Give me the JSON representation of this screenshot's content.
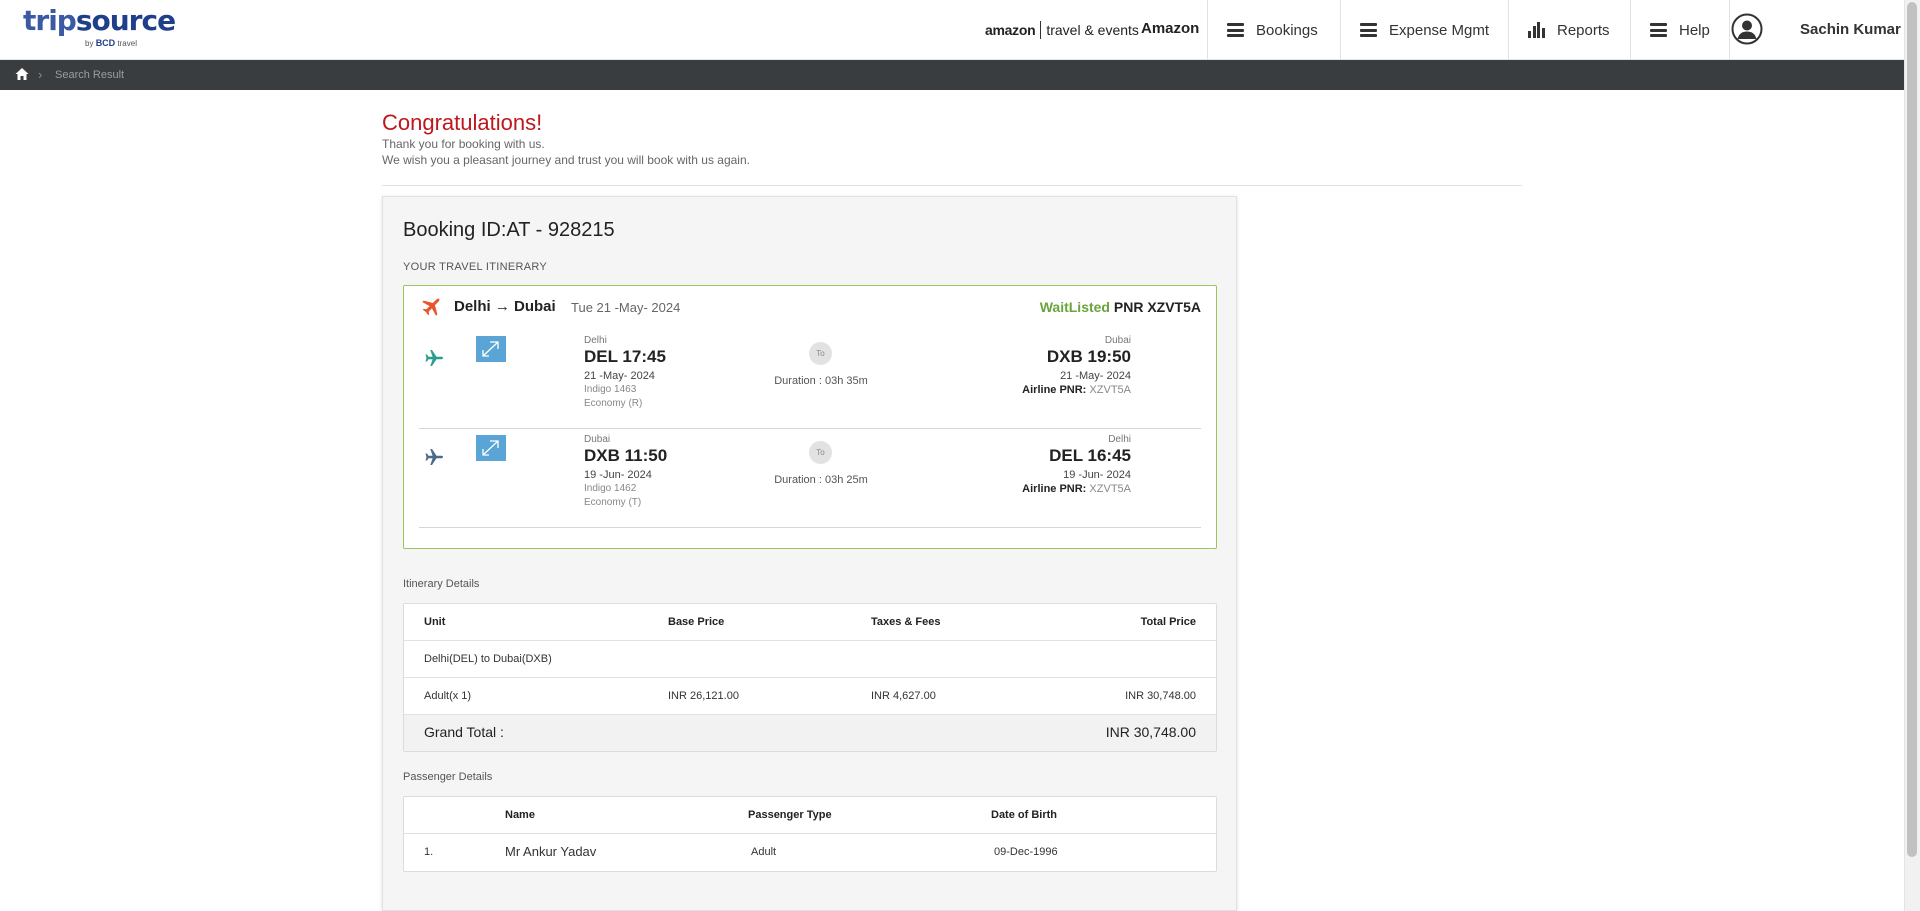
{
  "header": {
    "logo_main_a": "trip",
    "logo_main_b": "source",
    "logo_by": "by",
    "logo_bcd": "BCD",
    "logo_travel": "travel",
    "company_logo_amazon": "amazon",
    "company_logo_suffix": "travel & events",
    "company_name": "Amazon",
    "nav": [
      {
        "label": "Bookings",
        "icon": "hamburger-icon"
      },
      {
        "label": "Expense Mgmt",
        "icon": "hamburger-icon"
      },
      {
        "label": "Reports",
        "icon": "bar-chart-icon"
      },
      {
        "label": "Help",
        "icon": "hamburger-icon"
      }
    ],
    "user_name": "Sachin Kumar"
  },
  "breadcrumb": {
    "home_icon": "home-icon",
    "separator": "›",
    "current": "Search Result"
  },
  "confirmation": {
    "title": "Congratulations!",
    "line1": "Thank you for booking with us.",
    "line2": "We wish you a pleasant journey and trust you will book with us again."
  },
  "booking": {
    "id_label": "Booking ID:AT - 928215",
    "itinerary_label": "YOUR TRAVEL ITINERARY",
    "route": "Delhi → Dubai",
    "route_date": "Tue 21 -May- 2024",
    "status": "WaitListed",
    "pnr": "PNR XZVT5A",
    "segments": [
      {
        "from_city": "Delhi",
        "from_time": "DEL 17:45",
        "from_date": "21 -May- 2024",
        "flight": "Indigo 1463",
        "cabin": "Economy (R)",
        "to_label": "To",
        "duration": "Duration : 03h 35m",
        "to_city": "Dubai",
        "to_time": "DXB 19:50",
        "to_date": "21 -May- 2024",
        "airline_pnr_label": "Airline PNR:",
        "airline_pnr": "XZVT5A"
      },
      {
        "from_city": "Dubai",
        "from_time": "DXB 11:50",
        "from_date": "19 -Jun- 2024",
        "flight": "Indigo 1462",
        "cabin": "Economy (T)",
        "to_label": "To",
        "duration": "Duration : 03h 25m",
        "to_city": "Delhi",
        "to_time": "DEL 16:45",
        "to_date": "19 -Jun- 2024",
        "airline_pnr_label": "Airline PNR:",
        "airline_pnr": "XZVT5A"
      }
    ]
  },
  "pricing": {
    "section_label": "Itinerary Details",
    "headers": [
      "Unit",
      "Base Price",
      "Taxes & Fees",
      "Total Price"
    ],
    "route_row": "Delhi(DEL) to Dubai(DXB)",
    "rows": [
      {
        "unit": "Adult(x 1)",
        "base": "INR 26,121.00",
        "taxes": "INR 4,627.00",
        "total": "INR 30,748.00"
      }
    ],
    "grand_total_label": "Grand Total :",
    "grand_total": "INR 30,748.00"
  },
  "passengers": {
    "section_label": "Passenger Details",
    "headers": [
      "",
      "Name",
      "Passenger Type",
      "Date of Birth"
    ],
    "rows": [
      {
        "index": "1.",
        "name": "Mr Ankur Yadav",
        "type": "Adult",
        "dob": "09-Dec-1996"
      }
    ]
  },
  "colors": {
    "congrats_red": "#c0161c",
    "waitlisted_green": "#6aa43a",
    "itinerary_border": "#9dc35a",
    "breadcrumb_bg": "#3a3d40",
    "route_plane_orange": "#e8542b",
    "segment_plane_teal": "#2a9d8f",
    "segment_plane_blue": "#4a6b8a"
  }
}
